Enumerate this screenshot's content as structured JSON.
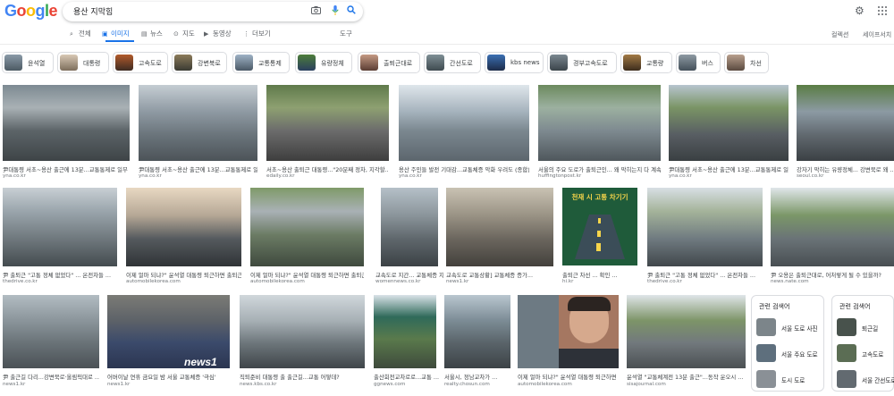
{
  "logo": "Google",
  "search": {
    "query": "용산 지막힘"
  },
  "tabs": [
    {
      "label": "전체",
      "icon": "search-icon"
    },
    {
      "label": "이미지",
      "icon": "image-icon",
      "active": true
    },
    {
      "label": "뉴스",
      "icon": "news-icon"
    },
    {
      "label": "지도",
      "icon": "map-pin-icon"
    },
    {
      "label": "동영상",
      "icon": "video-icon"
    },
    {
      "label": "더보기",
      "icon": "more-vert-icon"
    }
  ],
  "tools_label": "도구",
  "right_links": [
    "컬렉션",
    "세이프서치"
  ],
  "chips": [
    "윤석열",
    "대통령",
    "고속도로",
    "강변북로",
    "교통통제",
    "유량정체",
    "출퇴근대로",
    "간선도로",
    "kbs news",
    "경부고속도로",
    "교통량",
    "버스",
    "차선"
  ],
  "results": [
    {
      "caption": "尹대통령 서초~용산 출근에 13분...교통통제로 일부 ...",
      "source": "yna.co.kr"
    },
    {
      "caption": "尹대통령 서초~용산 출근에 13분...교통통제로 일부...",
      "source": "yna.co.kr"
    },
    {
      "caption": "서초~용산 출퇴근 대통령...\"20분째 정차, 지각할...",
      "source": "edaily.co.kr"
    },
    {
      "caption": "용산 주민들 발전 기대감...교통체증 악화 우려도 (종합)",
      "source": "yna.co.kr"
    },
    {
      "caption": "서울의 주요 도로가 출퇴근인... 왜 막히는지 다 계속...",
      "source": "huffingtonpost.kr"
    },
    {
      "caption": "尹대통령 서초~용산 출근에 13분...교통통제로 일부 ...",
      "source": "yna.co.kr"
    },
    {
      "caption": "강자기 막히는 유량정체... 강변북로 왜 ...",
      "source": "seoul.co.kr"
    },
    {
      "caption": "尹 출퇴근 \"고통 정체 없었다\" ... 온전차들 ...",
      "source": "thedrive.co.kr"
    },
    {
      "caption": "이제 얼마 되냐?\" 윤석열 대통령 퇴근하면 출퇴근...",
      "source": "automobilekorea.com"
    },
    {
      "caption": "이제 얼마 되냐?\" 윤석열 대통령 퇴근하면 출퇴근...",
      "source": "automobilekorea.com"
    },
    {
      "caption": "교속도로 지간... 교통체증 지속...",
      "source": "womennews.co.kr"
    },
    {
      "caption": "교속도로 교통상황] 교통체증 증가...",
      "source": "news1.kr"
    },
    {
      "caption": "출퇴근 차선 ... 확인 ...",
      "source": "hi.kr"
    },
    {
      "caption": "尹 출퇴근 \"고통 정체 없었다\" ... 온전차들 ...",
      "source": "thedrive.co.kr"
    },
    {
      "caption": "尹 오용은 출퇴근대로, 어처렇게 될 수 있을까?",
      "source": "news.nate.com"
    },
    {
      "caption": "尹 출근길 다리...강변북로·올림픽대로 ...",
      "source": "news1.kr"
    },
    {
      "caption": "어버이날 연휴 금요일 밤 서울 교통체증 '극심'",
      "source": "news1.kr"
    },
    {
      "caption": "직퇴준비 대통령 출 출근길...교통 어떻데?",
      "source": "news.kbs.co.kr"
    },
    {
      "caption": "출산회전교차로로...교통 ...",
      "source": "ggnews.com"
    },
    {
      "caption": "서울시, 정남교차가 ...",
      "source": "realty.chosun.com"
    },
    {
      "caption": "이제 얼마 되냐?\" 윤석열 대통령 퇴근하면 ...",
      "source": "automobilekorea.com"
    },
    {
      "caption": "윤석열 \"교통체계전 13분 출근\"...동작 운오시 ...",
      "source": "sisajournal.com"
    }
  ],
  "poster": {
    "text": "천재 시 고통 차기기"
  },
  "news1_mark": "news1",
  "related_left": {
    "title": "관련 검색어",
    "items": [
      "서울 도로 사진",
      "서울 주요 도로",
      "도시 도로"
    ]
  },
  "related_right": {
    "title": "관련 검색어",
    "items": [
      "퇴근길",
      "고속도로",
      "서울 간선도로"
    ]
  },
  "colors": {
    "accent": "#1a73e8",
    "text": "#3c4043",
    "muted": "#70757a"
  }
}
